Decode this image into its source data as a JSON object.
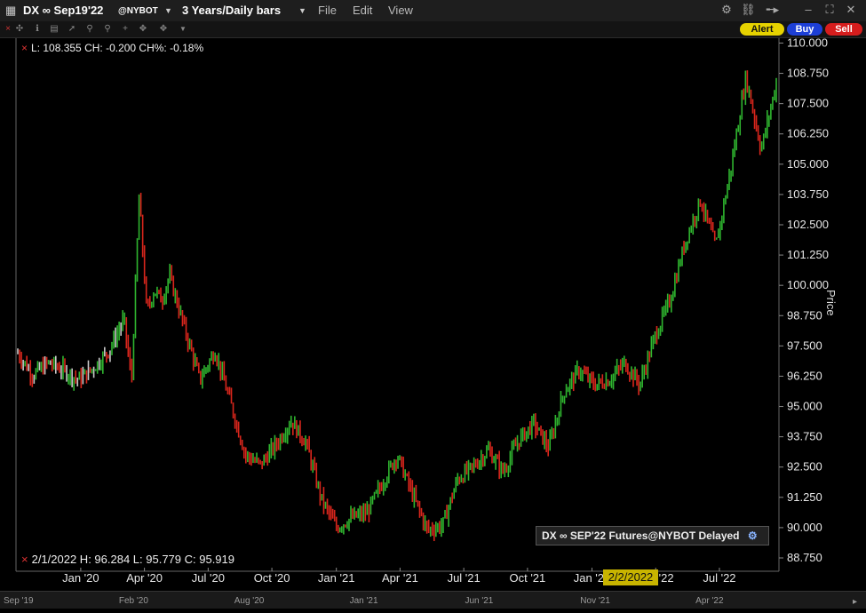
{
  "window": {
    "symbol": "DX ∞ Sep19'22",
    "exchange": "@NYBOT",
    "timeframe": "3 Years/Daily bars",
    "menu": [
      "File",
      "Edit",
      "View"
    ],
    "actions": {
      "alert": "Alert",
      "buy": "Buy",
      "sell": "Sell"
    },
    "colors": {
      "alert_bg": "#e6d200",
      "buy_bg": "#1d3fd6",
      "sell_bg": "#d61d1d",
      "up_bar": "#2fb52f",
      "down_bar": "#d9261c",
      "neutral_bar": "#c9c9c9"
    }
  },
  "info_top": "L: 108.355  CH: -0.200  CH%: -0.18%",
  "info_bottom": "2/1/2022   H: 96.284   L: 95.779   C: 95.919",
  "legend_label": "DX ∞ SEP'22 Futures@NYBOT Delayed",
  "cursor_date": "2/2/2022",
  "chart_data": {
    "type": "line",
    "ylabel": "Price",
    "ylim": [
      88.2,
      110.2
    ],
    "y_ticks": [
      "110.000",
      "108.750",
      "107.500",
      "106.250",
      "105.000",
      "103.750",
      "102.500",
      "101.250",
      "100.000",
      "98.750",
      "97.500",
      "96.250",
      "95.000",
      "93.750",
      "92.500",
      "91.250",
      "90.000",
      "88.750"
    ],
    "x_ticks": [
      {
        "label": "Jan '20",
        "t": 0.083
      },
      {
        "label": "Apr '20",
        "t": 0.167
      },
      {
        "label": "Jul '20",
        "t": 0.251
      },
      {
        "label": "Oct '20",
        "t": 0.335
      },
      {
        "label": "Jan '21",
        "t": 0.42
      },
      {
        "label": "Apr '21",
        "t": 0.504
      },
      {
        "label": "Jul '21",
        "t": 0.588
      },
      {
        "label": "Oct '21",
        "t": 0.672
      },
      {
        "label": "Jan '22",
        "t": 0.757
      },
      {
        "label": "Apr '22",
        "t": 0.841
      },
      {
        "label": "Jul '22",
        "t": 0.925
      }
    ],
    "scroll_labels": [
      {
        "label": "Sep '19",
        "t": 0.0
      },
      {
        "label": "Feb '20",
        "t": 0.151
      },
      {
        "label": "Aug '20",
        "t": 0.302
      },
      {
        "label": "Jan '21",
        "t": 0.453
      },
      {
        "label": "Jun '21",
        "t": 0.604
      },
      {
        "label": "Nov '21",
        "t": 0.755
      },
      {
        "label": "Apr '22",
        "t": 0.906
      }
    ],
    "series": [
      {
        "t": [
          0.0,
          0.02,
          0.04,
          0.06,
          0.08,
          0.1,
          0.12,
          0.14,
          0.15,
          0.16,
          0.17,
          0.18,
          0.19,
          0.2,
          0.22,
          0.24,
          0.26,
          0.28,
          0.3,
          0.32,
          0.34,
          0.36,
          0.38,
          0.4,
          0.42,
          0.44,
          0.46,
          0.48,
          0.5,
          0.52,
          0.54,
          0.56,
          0.58,
          0.6,
          0.62,
          0.64,
          0.66,
          0.68,
          0.7,
          0.72,
          0.74,
          0.76,
          0.78,
          0.8,
          0.82,
          0.84,
          0.86,
          0.88,
          0.9,
          0.92,
          0.94,
          0.96,
          0.98,
          1.0
        ],
        "values": [
          97.2,
          96.3,
          96.8,
          96.5,
          96.1,
          96.6,
          97.3,
          98.6,
          96.0,
          103.7,
          98.9,
          99.8,
          99.4,
          100.4,
          98.2,
          96.1,
          97.3,
          95.2,
          93.0,
          92.6,
          93.4,
          94.4,
          93.5,
          91.2,
          90.0,
          90.4,
          90.6,
          91.8,
          93.0,
          91.4,
          89.9,
          90.1,
          92.0,
          92.5,
          93.2,
          92.3,
          93.6,
          94.3,
          93.3,
          95.6,
          96.5,
          95.9,
          96.1,
          96.8,
          95.9,
          97.9,
          99.4,
          101.8,
          103.5,
          101.6,
          104.8,
          108.6,
          105.6,
          108.35
        ]
      }
    ]
  }
}
